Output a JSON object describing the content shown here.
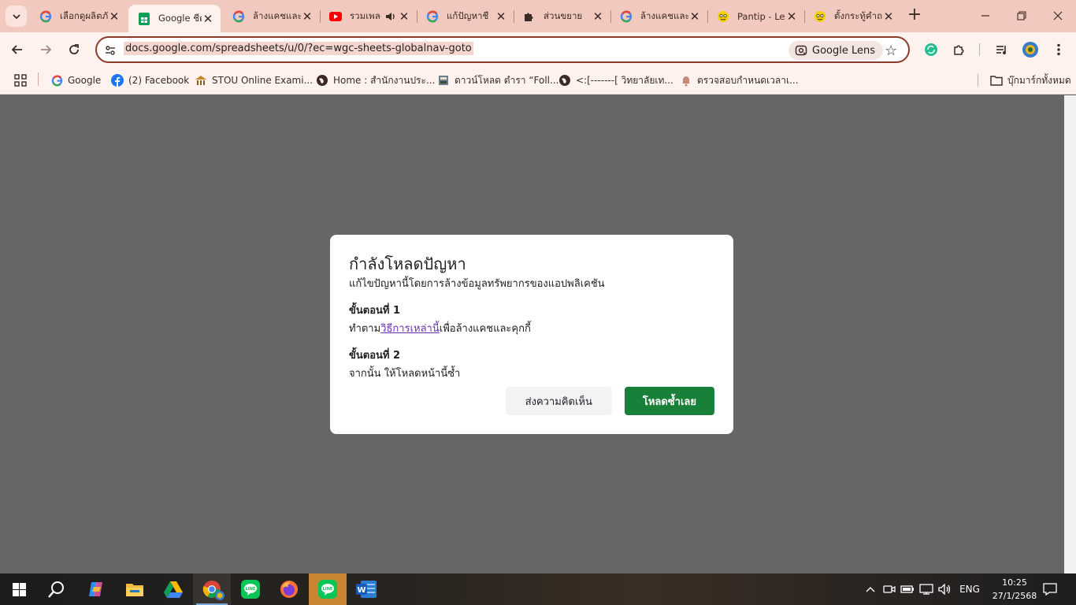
{
  "tabs": [
    {
      "title": "เลือกดูผลิตภั",
      "favicon": "google-icon"
    },
    {
      "title": "Google ชีต",
      "favicon": "sheets-icon",
      "active": true
    },
    {
      "title": "ล้างแคชและค",
      "favicon": "google-icon"
    },
    {
      "title": "รวมเพลง",
      "favicon": "youtube-icon",
      "audio": true
    },
    {
      "title": "แก้ปัญหาชี",
      "favicon": "google-icon"
    },
    {
      "title": "ส่วนขยาย",
      "favicon": "puzzle-icon"
    },
    {
      "title": "ล้างแคชและ",
      "favicon": "google-icon"
    },
    {
      "title": "Pantip - Le",
      "favicon": "pantip-icon"
    },
    {
      "title": "ตั้งกระทู้คำถ",
      "favicon": "pantip-icon"
    }
  ],
  "toolbar": {
    "url": "docs.google.com/spreadsheets/u/0/?ec=wgc-sheets-globalnav-goto",
    "lens_label": "Google Lens"
  },
  "bookmarks": [
    {
      "label": "Google",
      "icon": "google-icon"
    },
    {
      "label": "(2) Facebook",
      "icon": "facebook-icon"
    },
    {
      "label": "STOU Online Exami...",
      "icon": "stou-icon"
    },
    {
      "label": "Home : สำนักงานประ...",
      "icon": "globe-icon"
    },
    {
      "label": "ดาวน์โหลด ตำรา “Foll...",
      "icon": "book-icon"
    },
    {
      "label": "<:[-------[ วิทยาลัยเท...",
      "icon": "globe-icon"
    },
    {
      "label": "ตรวจสอบกำหนดเวลาเ...",
      "icon": "bell-icon"
    }
  ],
  "all_bookmarks_label": "บุ๊กมาร์กทั้งหมด",
  "dialog": {
    "title": "กำลังโหลดปัญหา",
    "subtitle": "แก้ไขปัญหานี้โดยการล้างข้อมูลทรัพยากรของแอปพลิเคชัน",
    "step1_heading": "ขั้นตอนที่ 1",
    "step1_prefix": "ทำตาม",
    "step1_link": "วิธีการเหล่านี้",
    "step1_suffix": "เพื่อล้างแคชและคุกกี้",
    "step2_heading": "ขั้นตอนที่ 2",
    "step2_text": "จากนั้น ให้โหลดหน้านี้ซ้ำ",
    "feedback_label": "ส่งความคิดเห็น",
    "reload_label": "โหลดซ้ำเลย"
  },
  "taskbar": {
    "language": "ENG",
    "time": "10:25",
    "date": "27/1/2568"
  },
  "colors": {
    "tabstrip": "#f2c9bf",
    "toolbar": "#fdf2ee",
    "reload_button": "#188038",
    "overlay": "#666666"
  }
}
